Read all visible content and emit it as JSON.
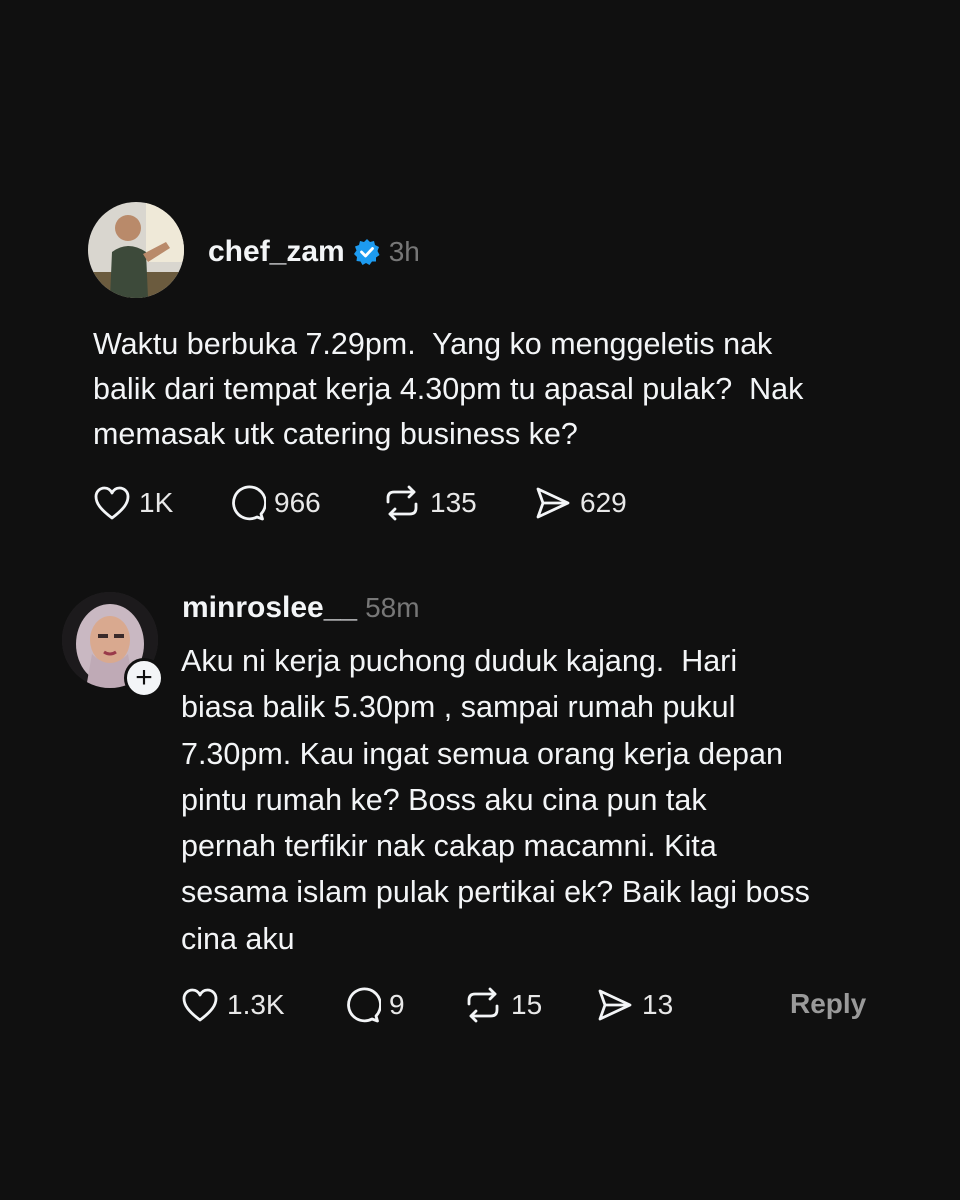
{
  "post": {
    "username": "chef_zam",
    "verified": true,
    "time": "3h",
    "text": "Waktu berbuka 7.29pm.  Yang ko menggeletis nak\nbalik dari tempat kerja 4.30pm tu apasal pulak?  Nak\nmemasak utk catering business ke?",
    "likes": "1K",
    "comments": "966",
    "reposts": "135",
    "shares": "629"
  },
  "reply": {
    "username": "minroslee__",
    "time": "58m",
    "text": "Aku ni kerja puchong duduk kajang.  Hari\nbiasa balik 5.30pm , sampai rumah pukul\n7.30pm. Kau ingat semua orang kerja depan\npintu rumah ke? Boss aku cina pun tak\npernah terfikir nak cakap macamni. Kita\nsesama islam pulak pertikai ek? Baik lagi boss\ncina aku",
    "likes": "1.3K",
    "comments": "9",
    "reposts": "15",
    "shares": "13",
    "reply_label": "Reply",
    "follow_symbol": "+"
  },
  "colors": {
    "background": "#101010",
    "text": "#f3f5f7",
    "muted": "#777777",
    "verified": "#1d9bf0"
  }
}
